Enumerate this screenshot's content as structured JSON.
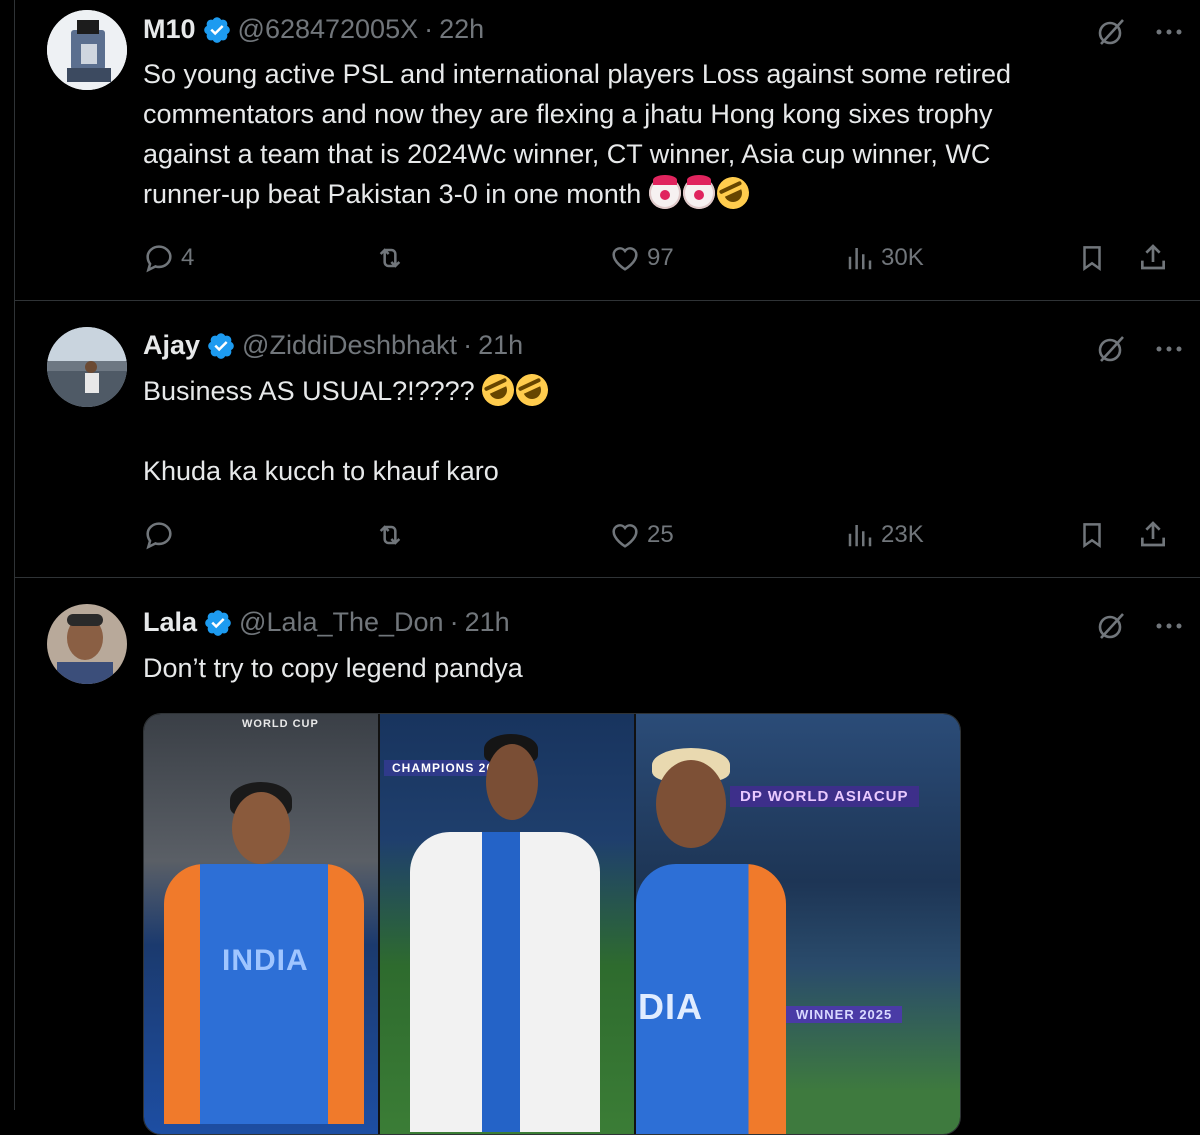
{
  "tweets": [
    {
      "name": "M10",
      "handle": "@628472005X",
      "time": "22h",
      "lines": [
        "So young active PSL and international players Loss against some retired",
        "commentators and now they are flexing a jhatu Hong kong sixes trophy",
        "against a team that is 2024Wc winner, CT winner, Asia cup winner, WC",
        "runner-up beat Pakistan 3-0 in one month"
      ],
      "emojis": [
        "clown-face",
        "clown-face",
        "rofl-face"
      ],
      "stats": {
        "replies": "4",
        "reposts": "",
        "likes": "97",
        "views": "30K"
      }
    },
    {
      "name": "Ajay",
      "handle": "@ZiddiDeshbhakt",
      "time": "21h",
      "lines": [
        "Business AS USUAL?!????",
        "",
        "Khuda ka kucch to khauf karo"
      ],
      "emojis": [
        "rofl-face",
        "rofl-face"
      ],
      "stats": {
        "replies": "",
        "reposts": "",
        "likes": "25",
        "views": "23K"
      }
    },
    {
      "name": "Lala",
      "handle": "@Lala_The_Don",
      "time": "21h",
      "lines": [
        "Don’t try to copy legend pandya"
      ],
      "media_banners": [
        "WORLD CUP",
        "CHAMPIONS 202",
        "INDIA",
        "DP WORLD ASIACUP",
        "WINNER 2025",
        "INDIA",
        "DIA"
      ]
    }
  ],
  "separator": "·",
  "colors": {
    "background": "#000000",
    "text": "#e7e9ea",
    "muted": "#71767b",
    "verified": "#1d9bf0",
    "border": "#2f3336"
  },
  "icons": [
    "verified-badge-icon",
    "grok-icon",
    "more-icon",
    "reply-icon",
    "repost-icon",
    "like-icon",
    "views-icon",
    "bookmark-icon",
    "share-icon"
  ]
}
